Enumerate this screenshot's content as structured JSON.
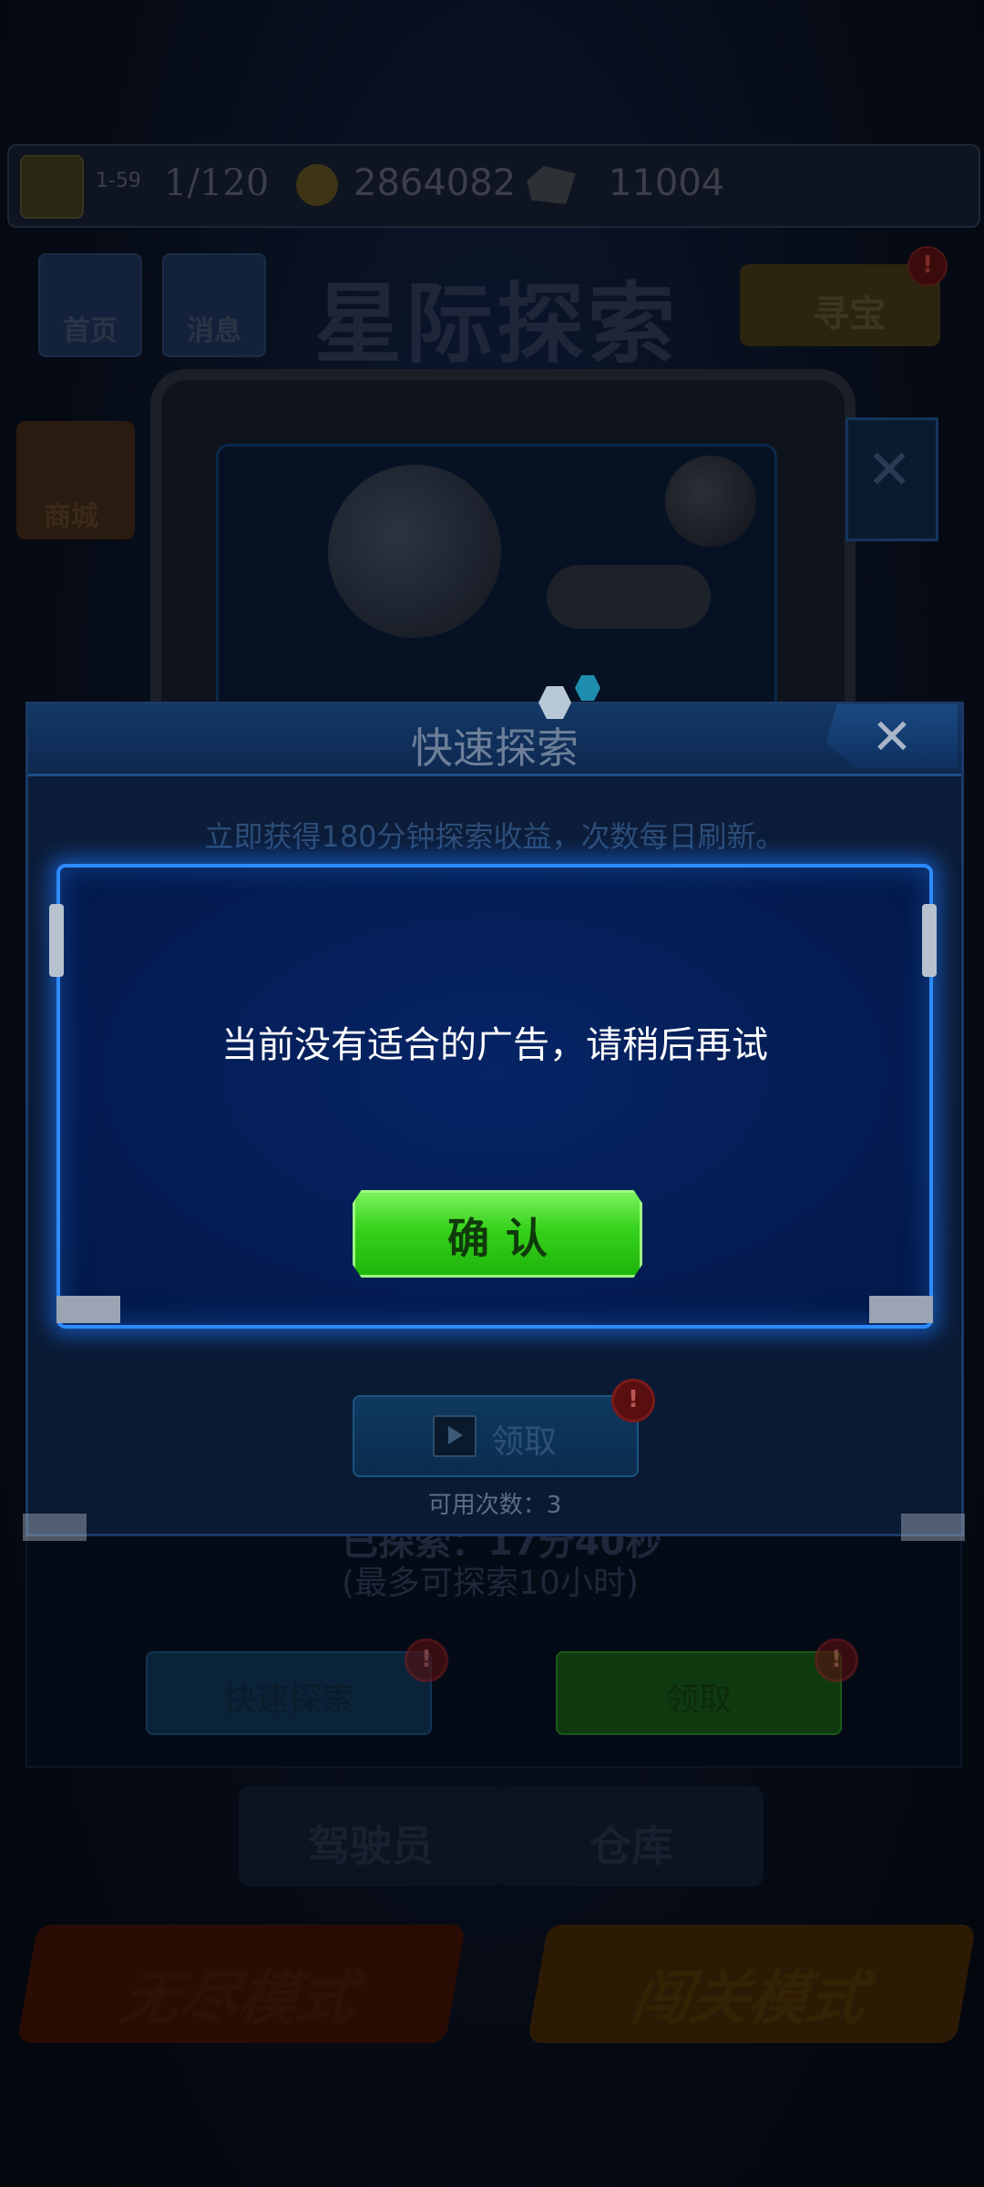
{
  "top_bar": {
    "level": "1-59",
    "progress": "1/120",
    "coins": "2864082",
    "gems": "11004"
  },
  "menu": {
    "home_label": "首页",
    "message_label": "消息",
    "game_title": "星际探索",
    "treasure_label": "寻宝",
    "mailbox_label": "商城"
  },
  "explore_info": {
    "explored_label": "已探索：17分40秒",
    "max_label": "(最多可探索10小时)",
    "quick_explore_button": "快速探索",
    "claim_button": "领取"
  },
  "bottom_tabs": {
    "pilot": "驾驶员",
    "warehouse": "仓库",
    "endless_mode": "无尽模式",
    "level_mode": "闯关模式"
  },
  "quick_explore_dialog": {
    "title": "快速探索",
    "description": "立即获得180分钟探索收益，次数每日刷新。",
    "claim_label": "领取",
    "uses_label": "可用次数：3",
    "badge": "!"
  },
  "alert_popup": {
    "message": "当前没有适合的广告，请稍后再试",
    "confirm_label": "确认"
  },
  "close_symbol": "✕"
}
